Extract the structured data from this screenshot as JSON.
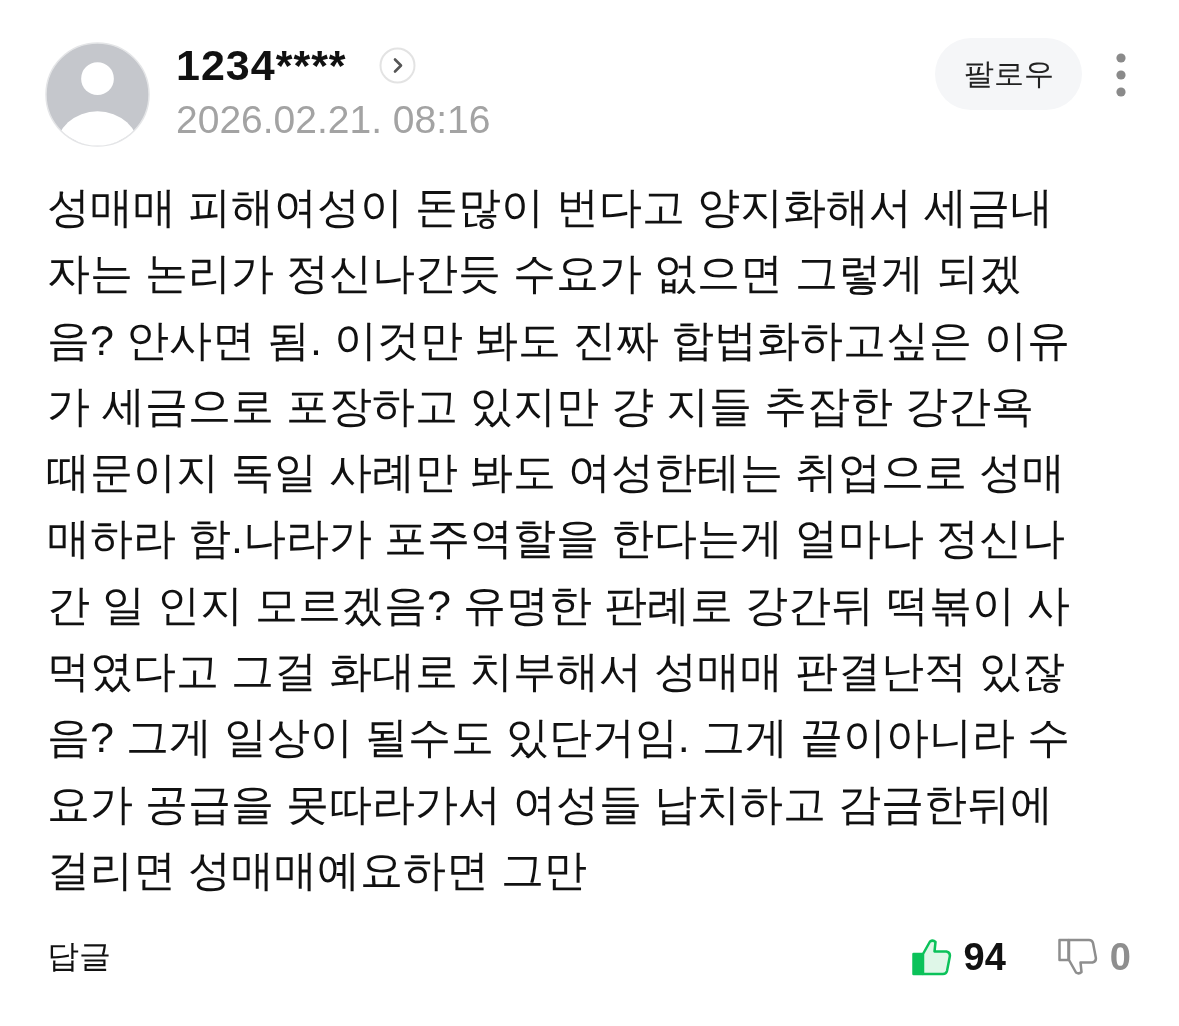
{
  "author": {
    "name": "1234****",
    "date": "2026.02.21. 08:16"
  },
  "follow_button": {
    "label": "팔로우"
  },
  "comment": {
    "text": "성매매 피해여성이 돈많이 번다고 양지화해서 세금내자는 논리가 정신나간듯 수요가 없으면 그렇게 되겠음? 안사면 됨. 이것만 봐도 진짜 합법화하고싶은 이유가 세금으로 포장하고 있지만 걍 지들 추잡한 강간욕때문이지 독일 사례만 봐도 여성한테는 취업으로 성매매하라 함.나라가 포주역할을 한다는게 얼마나 정신나간 일 인지 모르겠음? 유명한 판례로 강간뒤 떡볶이 사먹였다고 그걸 화대로 치부해서 성매매 판결난적 있잖음? 그게 일상이 될수도 있단거임. 그게 끝이아니라 수요가 공급을 못따라가서 여성들 납치하고 감금한뒤에 걸리면 성매매예요하면 그만"
  },
  "reply_link": {
    "label": "답글"
  },
  "reactions": [
    {
      "kind": "like",
      "count": "94",
      "selected": true
    },
    {
      "kind": "dislike",
      "count": "0",
      "selected": false
    }
  ]
}
